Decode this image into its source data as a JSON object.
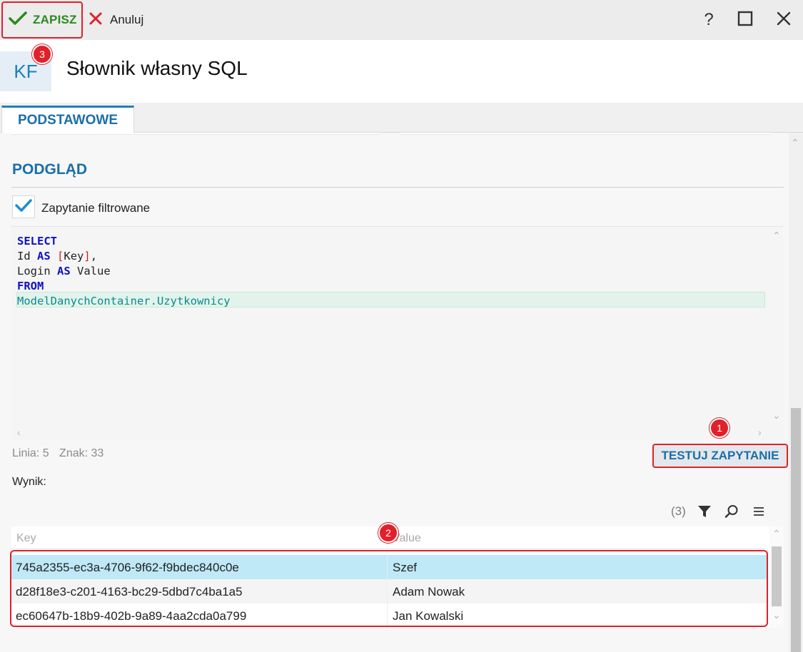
{
  "toolbar": {
    "save_label": "ZAPISZ",
    "cancel_label": "Anuluj",
    "help_label": "?"
  },
  "header": {
    "icon_text": "KF",
    "title": "Słownik własny SQL"
  },
  "tabs": [
    {
      "label": "PODSTAWOWE",
      "active": true
    }
  ],
  "preview": {
    "section_title": "PODGLĄD",
    "filter_checkbox_label": "Zapytanie filtrowane",
    "filter_checked": true
  },
  "editor": {
    "lines": [
      {
        "parts": [
          {
            "text": "SELECT",
            "style": "keyword"
          }
        ]
      },
      {
        "parts": [
          {
            "text": "Id ",
            "style": "plain"
          },
          {
            "text": "AS",
            "style": "keyword"
          },
          {
            "text": " ",
            "style": "plain"
          },
          {
            "text": "[",
            "style": "bracket"
          },
          {
            "text": "Key",
            "style": "plain"
          },
          {
            "text": "]",
            "style": "bracket"
          },
          {
            "text": ",",
            "style": "plain"
          }
        ]
      },
      {
        "parts": [
          {
            "text": "Login ",
            "style": "plain"
          },
          {
            "text": "AS",
            "style": "keyword"
          },
          {
            "text": " Value",
            "style": "plain"
          }
        ]
      },
      {
        "parts": [
          {
            "text": "FROM",
            "style": "keyword"
          }
        ]
      },
      {
        "parts": [
          {
            "text": "ModelDanychContainer.Uzytkownicy",
            "style": "table"
          }
        ]
      }
    ],
    "status_line": "Linia: 5",
    "status_char": "Znak: 33"
  },
  "actions": {
    "test_query_label": "TESTUJ ZAPYTANIE"
  },
  "result": {
    "label": "Wynik:",
    "count_text": "(3)",
    "columns": [
      "Key",
      "Value"
    ],
    "rows": [
      {
        "key": "745a2355-ec3a-4706-9f62-f9bdec840c0e",
        "value": "Szef"
      },
      {
        "key": "d28f18e3-c201-4163-bc29-5dbd7c4ba1a5",
        "value": "Adam Nowak"
      },
      {
        "key": "ec60647b-18b9-402b-9a89-4aa2cda0a799",
        "value": "Jan Kowalski"
      }
    ]
  },
  "badges": [
    "1",
    "2",
    "3"
  ],
  "icons": {
    "save": "check-icon",
    "cancel": "x-icon",
    "help": "question-icon",
    "maximize": "maximize-icon",
    "close": "close-icon",
    "filter": "funnel-icon",
    "search": "search-icon",
    "menu": "hamburger-icon"
  },
  "colors": {
    "accent": "#1a6fa8",
    "save_green": "#2a8a1f",
    "annotation_red": "#e0202a",
    "selected_row": "#bfe9f7",
    "keyword_blue": "#1010c8",
    "table_teal": "#0b8a8a"
  }
}
